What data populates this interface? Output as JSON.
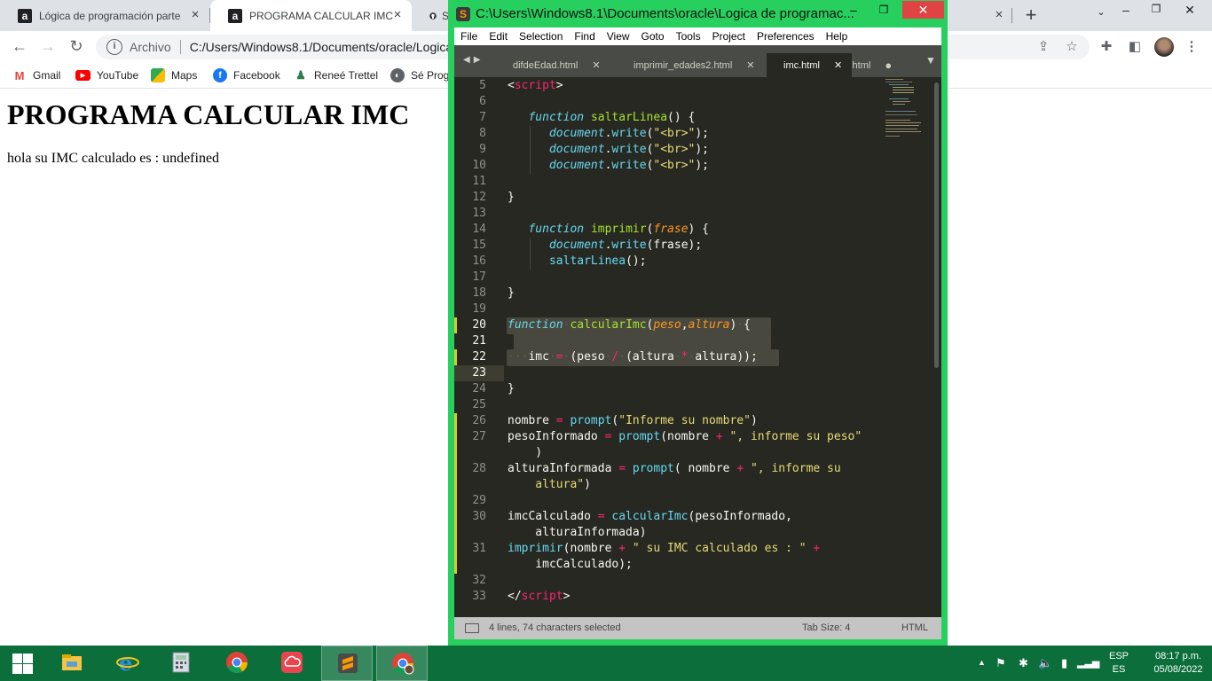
{
  "browser": {
    "tabs": [
      {
        "title": "Lógica de programación parte",
        "favicon": "alura-a-icon"
      },
      {
        "title": "PROGRAMA CALCULAR IMC IN",
        "favicon": "alura-a-icon"
      },
      {
        "title": "S",
        "favicon": "github-icon"
      }
    ],
    "new_tab_label": "+",
    "address_label": "Archivo",
    "address_value": "C:/Users/Windows8.1/Documents/oracle/Logica%20de%20programacion/imc.html",
    "bookmarks": [
      {
        "label": "Gmail",
        "icon": "gmail-icon",
        "color": "#ea4335"
      },
      {
        "label": "YouTube",
        "icon": "youtube-icon",
        "color": "#ff0000"
      },
      {
        "label": "Maps",
        "icon": "maps-icon",
        "color": "#34a853"
      },
      {
        "label": "Facebook",
        "icon": "facebook-icon",
        "color": "#1877f2"
      },
      {
        "label": "Reneé Trettel",
        "icon": "person-icon",
        "color": "#2f7d4f"
      },
      {
        "label": "Sé Prog",
        "icon": "globe-icon",
        "color": "#5f6368"
      }
    ]
  },
  "page": {
    "heading": "PROGRAMA CALCULAR IMC",
    "output": "hola su IMC calculado es : undefined"
  },
  "sublime": {
    "title": "C:\\Users\\Windows8.1\\Documents\\oracle\\Logica de programac...",
    "menu": [
      "File",
      "Edit",
      "Selection",
      "Find",
      "View",
      "Goto",
      "Tools",
      "Project",
      "Preferences",
      "Help"
    ],
    "tabs": [
      {
        "label": "difdeEdad.html",
        "active": false
      },
      {
        "label": "imprimir_edades2.html",
        "active": false
      },
      {
        "label": "imc.html",
        "active": true
      },
      {
        "label": "s.html",
        "active": false
      }
    ],
    "line_numbers": [
      "5",
      "6",
      "7",
      "8",
      "9",
      "10",
      "11",
      "12",
      "13",
      "14",
      "15",
      "16",
      "17",
      "18",
      "19",
      "20",
      "21",
      "22",
      "23",
      "24",
      "25",
      "26",
      "27",
      "28",
      "29",
      "30",
      "31",
      "32",
      "33"
    ],
    "status": {
      "selection": "4 lines, 74 characters selected",
      "tab_size": "Tab Size: 4",
      "syntax": "HTML"
    }
  },
  "taskbar": {
    "apps": [
      "file-explorer-icon",
      "internet-explorer-icon",
      "calculator-icon",
      "chrome-icon",
      "cloud-app-icon",
      "sublime-text-icon",
      "chrome-profile-icon"
    ],
    "lang_top": "ESP",
    "lang_bottom": "ES",
    "time": "08:17 p.m.",
    "date": "05/08/2022"
  },
  "colors": {
    "sublime_frame": "#27d05e",
    "taskbar": "#0b6e3b",
    "editor_bg": "#272822",
    "modified_marker": "#d8c92b"
  }
}
